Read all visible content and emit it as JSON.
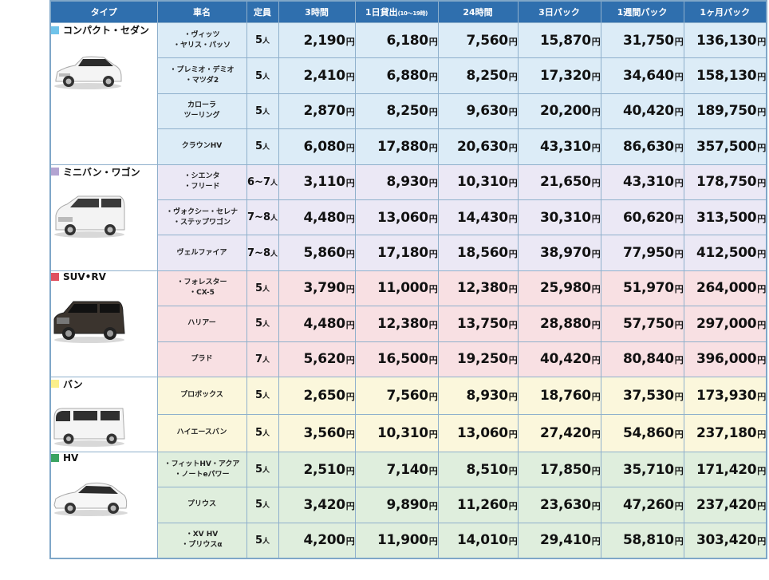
{
  "headers": [
    "タイプ",
    "車名",
    "定員",
    "3時間",
    "1日貸出",
    "(10〜19時)",
    "24時間",
    "3日パック",
    "1週間パック",
    "1ヶ月パック"
  ],
  "units": {
    "yen": "円",
    "person": "人"
  },
  "groups": [
    {
      "type": "コンパクト・セダン",
      "color": "#6fc3ea",
      "icon": "car-sedan-icon",
      "rows": [
        {
          "name": [
            "・ヴィッツ",
            "・ヤリス・パッソ"
          ],
          "cap": "5",
          "prices": [
            "2,190",
            "6,180",
            "7,560",
            "15,870",
            "31,750",
            "136,130"
          ]
        },
        {
          "name": [
            "・プレミオ・デミオ",
            "・マツダ2"
          ],
          "cap": "5",
          "prices": [
            "2,410",
            "6,880",
            "8,250",
            "17,320",
            "34,640",
            "158,130"
          ]
        },
        {
          "name": [
            "カローラ",
            "ツーリング"
          ],
          "cap": "5",
          "prices": [
            "2,870",
            "8,250",
            "9,630",
            "20,200",
            "40,420",
            "189,750"
          ]
        },
        {
          "name": [
            "クラウンHV"
          ],
          "cap": "5",
          "prices": [
            "6,080",
            "17,880",
            "20,630",
            "43,310",
            "86,630",
            "357,500"
          ]
        }
      ]
    },
    {
      "type": "ミニバン・ワゴン",
      "color": "#b3a4d1",
      "icon": "minivan-icon",
      "rows": [
        {
          "name": [
            "・シエンタ",
            "・フリード"
          ],
          "cap": "6~7",
          "prices": [
            "3,110",
            "8,930",
            "10,310",
            "21,650",
            "43,310",
            "178,750"
          ]
        },
        {
          "name": [
            "・ヴォクシー・セレナ",
            "・ステップワゴン"
          ],
          "cap": "7~8",
          "prices": [
            "4,480",
            "13,060",
            "14,430",
            "30,310",
            "60,620",
            "313,500"
          ]
        },
        {
          "name": [
            "ヴェルファイア"
          ],
          "cap": "7~8",
          "prices": [
            "5,860",
            "17,180",
            "18,560",
            "38,970",
            "77,950",
            "412,500"
          ]
        }
      ]
    },
    {
      "type": "SUV•RV",
      "color": "#e0505f",
      "icon": "suv-icon",
      "rows": [
        {
          "name": [
            "・フォレスター",
            "・CX-5"
          ],
          "cap": "5",
          "prices": [
            "3,790",
            "11,000",
            "12,380",
            "25,980",
            "51,970",
            "264,000"
          ]
        },
        {
          "name": [
            "ハリアー"
          ],
          "cap": "5",
          "prices": [
            "4,480",
            "12,380",
            "13,750",
            "28,880",
            "57,750",
            "297,000"
          ]
        },
        {
          "name": [
            "プラド"
          ],
          "cap": "7",
          "prices": [
            "5,620",
            "16,500",
            "19,250",
            "40,420",
            "80,840",
            "396,000"
          ]
        }
      ]
    },
    {
      "type": "バン",
      "color": "#fbef8c",
      "icon": "van-icon",
      "rows": [
        {
          "name": [
            "プロボックス"
          ],
          "cap": "5",
          "prices": [
            "2,650",
            "7,560",
            "8,930",
            "18,760",
            "37,530",
            "173,930"
          ]
        },
        {
          "name": [
            "ハイエースバン"
          ],
          "cap": "5",
          "prices": [
            "3,560",
            "10,310",
            "13,060",
            "27,420",
            "54,860",
            "237,180"
          ]
        }
      ]
    },
    {
      "type": "HV",
      "color": "#3aa361",
      "icon": "hybrid-car-icon",
      "rows": [
        {
          "name": [
            "・フィットHV・アクア",
            "・ノートeパワー"
          ],
          "cap": "5",
          "prices": [
            "2,510",
            "7,140",
            "8,510",
            "17,850",
            "35,710",
            "171,420"
          ]
        },
        {
          "name": [
            "プリウス"
          ],
          "cap": "5",
          "prices": [
            "3,420",
            "9,890",
            "11,260",
            "23,630",
            "47,260",
            "237,420"
          ]
        },
        {
          "name": [
            "・XV HV",
            "・プリウスα"
          ],
          "cap": "5",
          "prices": [
            "4,200",
            "11,900",
            "14,010",
            "29,410",
            "58,810",
            "303,420"
          ]
        }
      ]
    }
  ]
}
